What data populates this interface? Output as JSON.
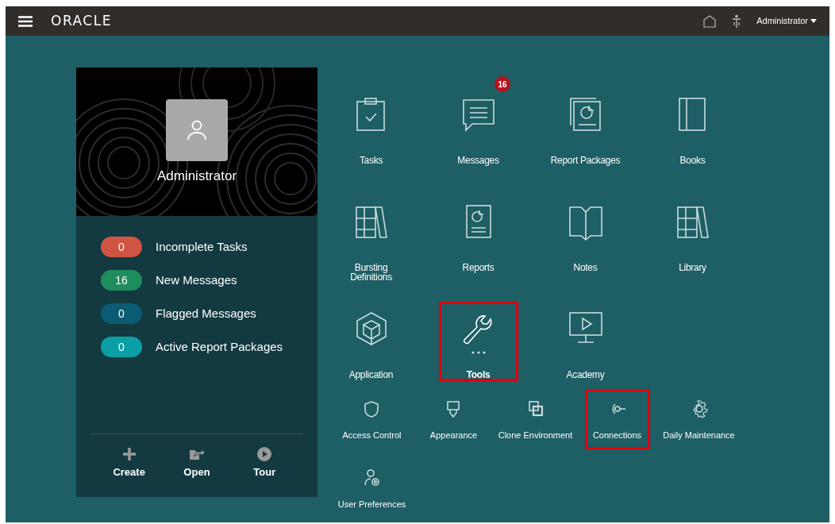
{
  "header": {
    "logo": "ORACLE",
    "user_menu": "Administrator"
  },
  "profile": {
    "name": "Administrator",
    "stats": [
      {
        "count": "0",
        "label": "Incomplete Tasks",
        "color": "#d05443"
      },
      {
        "count": "16",
        "label": "New Messages",
        "color": "#1f8c5d"
      },
      {
        "count": "0",
        "label": "Flagged Messages",
        "color": "#0b5b72"
      },
      {
        "count": "0",
        "label": "Active Report Packages",
        "color": "#0a9fa4"
      }
    ],
    "actions": [
      {
        "label": "Create"
      },
      {
        "label": "Open"
      },
      {
        "label": "Tour"
      }
    ]
  },
  "tiles": [
    {
      "label": "Tasks",
      "highlighted": false
    },
    {
      "label": "Messages",
      "badge": "16",
      "highlighted": false
    },
    {
      "label": "Report Packages",
      "highlighted": false
    },
    {
      "label": "Books",
      "highlighted": false
    },
    {
      "label": "Bursting Definitions",
      "highlighted": false
    },
    {
      "label": "Reports",
      "highlighted": false
    },
    {
      "label": "Notes",
      "highlighted": false
    },
    {
      "label": "Library",
      "highlighted": false
    },
    {
      "label": "Application",
      "highlighted": false
    },
    {
      "label": "Tools",
      "highlighted": true
    },
    {
      "label": "Academy",
      "highlighted": false
    }
  ],
  "tools_menu": [
    {
      "label": "Access Control",
      "highlighted": false
    },
    {
      "label": "Appearance",
      "highlighted": false
    },
    {
      "label": "Clone Environment",
      "highlighted": false
    },
    {
      "label": "Connections",
      "highlighted": true
    },
    {
      "label": "Daily Maintenance",
      "highlighted": false
    },
    {
      "label": "User Preferences",
      "highlighted": false
    }
  ]
}
